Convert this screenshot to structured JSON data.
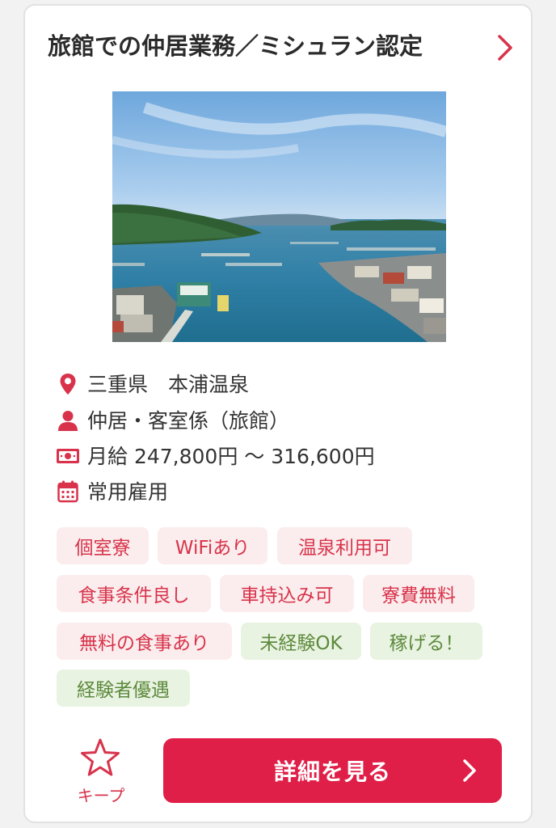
{
  "job": {
    "title": "旅館での仲居業務／ミシュラン認定",
    "photo_alt": "海と入り江の風景",
    "info": {
      "location": "三重県　本浦温泉",
      "job_type": "仲居・客室係（旅館）",
      "salary": "月給 247,800円 〜 316,600円",
      "employment": "常用雇用"
    },
    "tags": [
      {
        "label": "個室寮",
        "style": "red"
      },
      {
        "label": "WiFiあり",
        "style": "red"
      },
      {
        "label": "温泉利用可",
        "style": "red"
      },
      {
        "label": "食事条件良し",
        "style": "red"
      },
      {
        "label": "車持込み可",
        "style": "red"
      },
      {
        "label": "寮費無料",
        "style": "red"
      },
      {
        "label": "無料の食事あり",
        "style": "red"
      },
      {
        "label": "未経験OK",
        "style": "green"
      },
      {
        "label": "稼げる！",
        "style": "green"
      },
      {
        "label": "経験者優遇",
        "style": "green"
      }
    ],
    "keep_label": "キープ",
    "detail_label": "詳細を見る"
  },
  "colors": {
    "accent": "#e01f48",
    "tag_red_bg": "#fbeded",
    "tag_red_text": "#d8334b",
    "tag_green_bg": "#e9f3e2",
    "tag_green_text": "#5d8a3c"
  },
  "icons": [
    "location-pin-icon",
    "person-icon",
    "money-icon",
    "calendar-icon",
    "star-icon",
    "chevron-right-icon"
  ]
}
